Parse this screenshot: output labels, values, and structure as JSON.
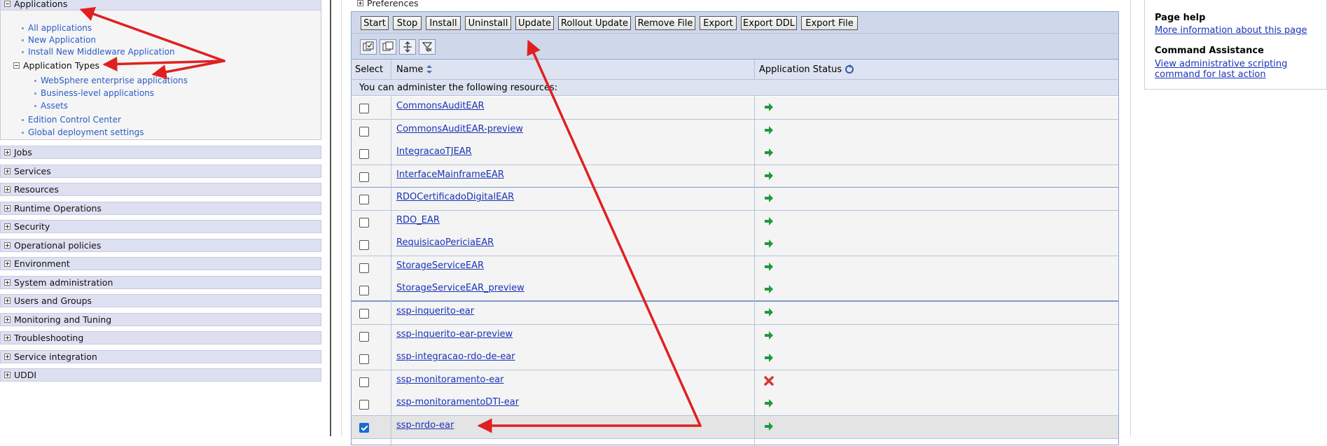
{
  "nav": {
    "applications": {
      "label": "Applications",
      "items": [
        "All applications",
        "New Application",
        "Install New Middleware Application"
      ],
      "types_label": "Application Types",
      "types": [
        "WebSphere enterprise applications",
        "Business-level applications",
        "Assets"
      ],
      "more": [
        "Edition Control Center",
        "Global deployment settings"
      ]
    },
    "sections": [
      "Jobs",
      "Services",
      "Resources",
      "Runtime Operations",
      "Security",
      "Operational policies",
      "Environment",
      "System administration",
      "Users and Groups",
      "Monitoring and Tuning",
      "Troubleshooting",
      "Service integration",
      "UDDI"
    ]
  },
  "main": {
    "preferences_label": "Preferences",
    "buttons": [
      "Start",
      "Stop",
      "Install",
      "Uninstall",
      "Update",
      "Rollout Update",
      "Remove File",
      "Export",
      "Export DDL",
      "Export File"
    ],
    "icon_buttons": [
      "select-all-icon",
      "deselect-all-icon",
      "show-filter-icon",
      "clear-filter-icon"
    ],
    "columns": {
      "select": "Select",
      "name": "Name",
      "status": "Application Status"
    },
    "notice": "You can administer the following resources:",
    "rows": [
      {
        "name": "CommonsAuditEAR",
        "status": "started",
        "checked": false
      },
      {
        "name": "CommonsAuditEAR-preview",
        "status": "started",
        "checked": false
      },
      {
        "name": "IntegracaoTJEAR",
        "status": "started",
        "checked": false
      },
      {
        "name": "InterfaceMainframeEAR",
        "status": "started",
        "checked": false
      },
      {
        "name": "RDOCertificadoDigitalEAR",
        "status": "started",
        "checked": false
      },
      {
        "name": "RDO_EAR",
        "status": "started",
        "checked": false
      },
      {
        "name": "RequisicaoPericiaEAR",
        "status": "started",
        "checked": false
      },
      {
        "name": "StorageServiceEAR",
        "status": "started",
        "checked": false
      },
      {
        "name": "StorageServiceEAR_preview",
        "status": "started",
        "checked": false
      },
      {
        "name": "ssp-inquerito-ear",
        "status": "started",
        "checked": false
      },
      {
        "name": "ssp-inquerito-ear-preview",
        "status": "started",
        "checked": false
      },
      {
        "name": "ssp-integracao-rdo-de-ear",
        "status": "started",
        "checked": false
      },
      {
        "name": "ssp-monitoramento-ear",
        "status": "stopped",
        "checked": false
      },
      {
        "name": "ssp-monitoramentoDTI-ear",
        "status": "started",
        "checked": false
      },
      {
        "name": "ssp-nrdo-ear",
        "status": "started",
        "checked": true
      }
    ]
  },
  "help": {
    "page_help_title": "Page help",
    "page_help_link": "More information about this page",
    "cmd_title": "Command Assistance",
    "cmd_link": "View administrative scripting command for last action"
  },
  "colors": {
    "started": "#1e9a3c",
    "stopped": "#d23a32",
    "annotation_arrow": "#e02020",
    "link": "#1933b8"
  }
}
